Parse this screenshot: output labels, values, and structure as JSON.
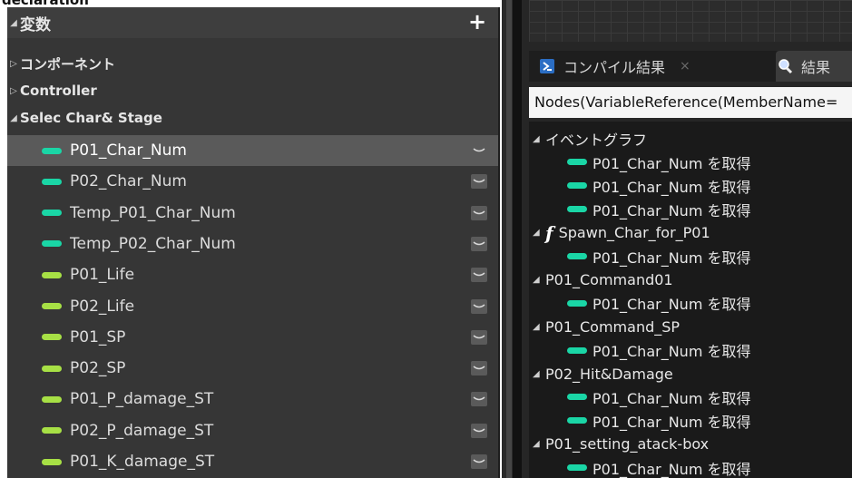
{
  "window": {
    "clipped_top_text": "declaration"
  },
  "variables_panel": {
    "header": {
      "label": "変数",
      "add_button": "+"
    },
    "categories": [
      {
        "label": "コンポーネント",
        "expanded": false
      },
      {
        "label": "Controller",
        "expanded": false
      },
      {
        "label": "Selec Char& Stage",
        "expanded": true
      }
    ],
    "items": [
      {
        "label": "P01_Char_Num",
        "type": "teal",
        "selected": true
      },
      {
        "label": "P02_Char_Num",
        "type": "teal"
      },
      {
        "label": "Temp_P01_Char_Num",
        "type": "teal"
      },
      {
        "label": "Temp_P02_Char_Num",
        "type": "teal"
      },
      {
        "label": "P01_Life",
        "type": "green"
      },
      {
        "label": "P02_Life",
        "type": "green"
      },
      {
        "label": "P01_SP",
        "type": "green"
      },
      {
        "label": "P02_SP",
        "type": "green"
      },
      {
        "label": "P01_P_damage_ST",
        "type": "green"
      },
      {
        "label": "P02_P_damage_ST",
        "type": "green"
      },
      {
        "label": "P01_K_damage_ST",
        "type": "green"
      }
    ]
  },
  "results_panel": {
    "tabs": [
      {
        "label": "コンパイル結果",
        "close": "×"
      },
      {
        "label": "結果"
      }
    ],
    "search": {
      "value": "Nodes(VariableReference(MemberName="
    },
    "results": [
      {
        "kind": "group",
        "label": "イベントグラフ"
      },
      {
        "kind": "node",
        "label": "P01_Char_Num を取得"
      },
      {
        "kind": "node",
        "label": "P01_Char_Num を取得"
      },
      {
        "kind": "node",
        "label": "P01_Char_Num を取得"
      },
      {
        "kind": "function",
        "label": "Spawn_Char_for_P01"
      },
      {
        "kind": "node",
        "label": "P01_Char_Num を取得"
      },
      {
        "kind": "group",
        "label": "P01_Command01"
      },
      {
        "kind": "node",
        "label": "P01_Char_Num を取得"
      },
      {
        "kind": "group",
        "label": "P01_Command_SP"
      },
      {
        "kind": "node",
        "label": "P01_Char_Num を取得"
      },
      {
        "kind": "group",
        "label": "P02_Hit&Damage"
      },
      {
        "kind": "node",
        "label": "P01_Char_Num を取得"
      },
      {
        "kind": "node",
        "label": "P01_Char_Num を取得"
      },
      {
        "kind": "group",
        "label": "P01_setting_atack-box"
      },
      {
        "kind": "node",
        "label": "P01_Char_Num を取得"
      }
    ]
  }
}
